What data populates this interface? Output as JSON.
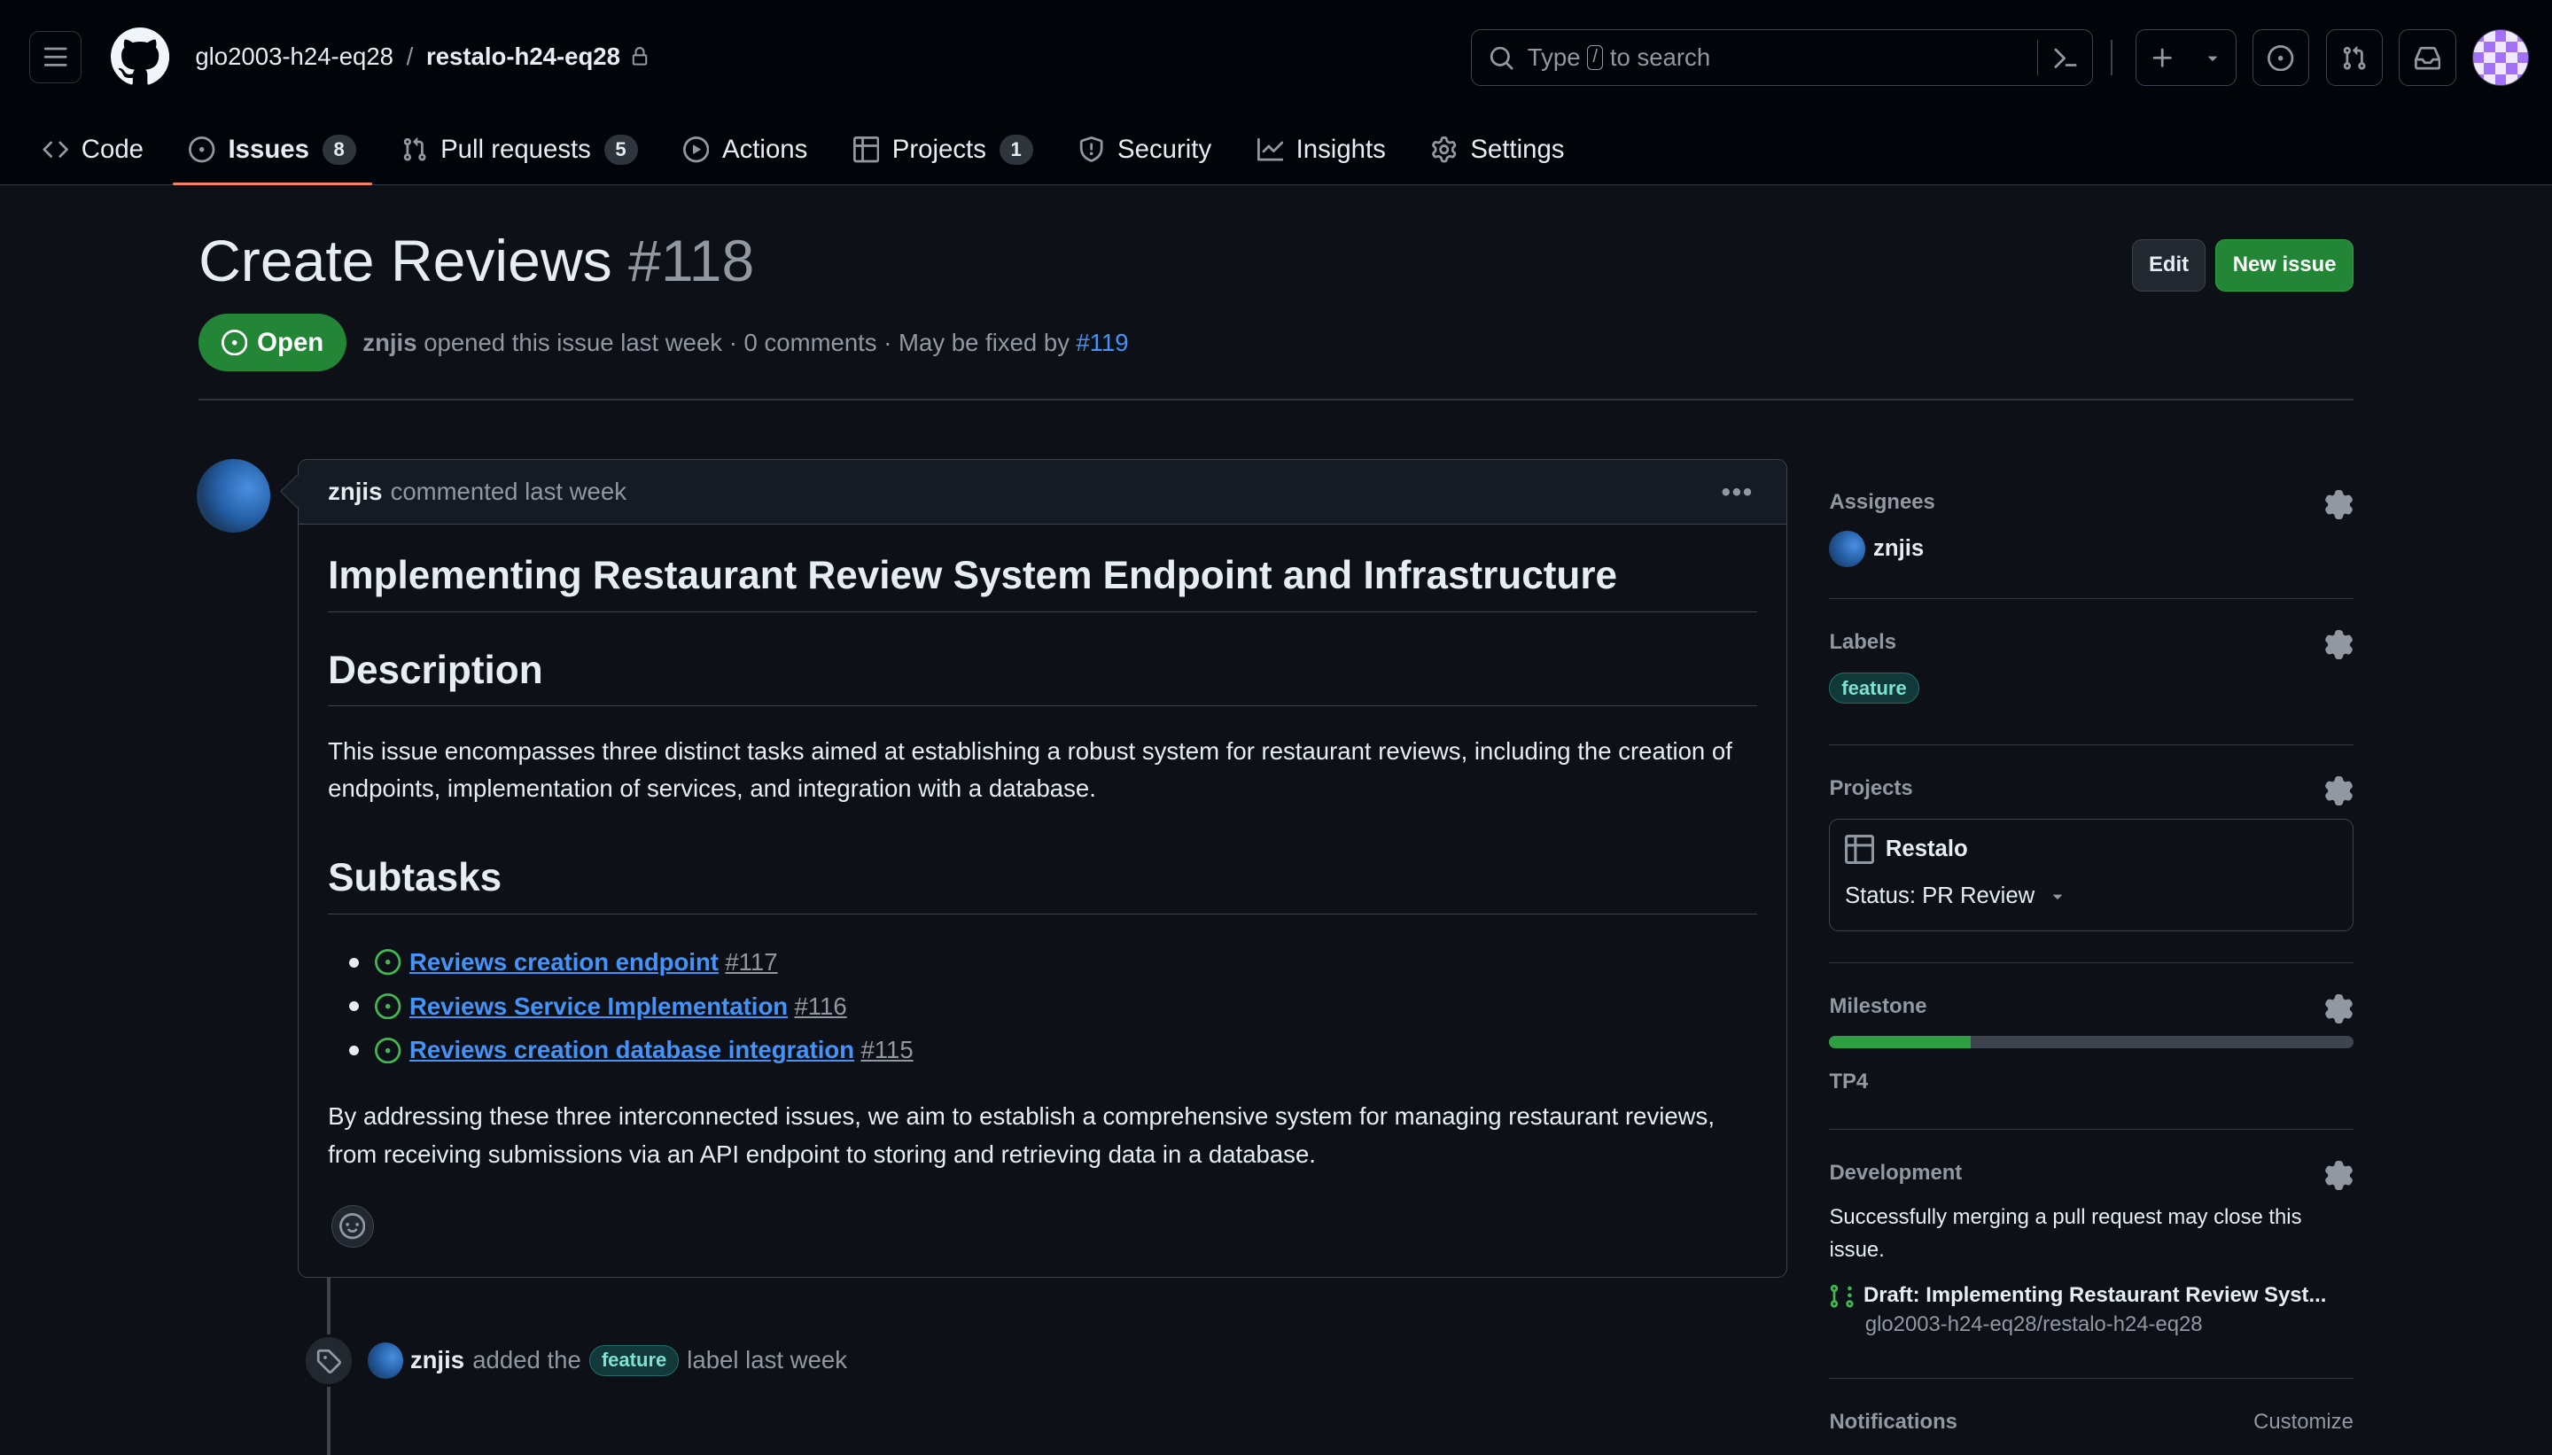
{
  "header": {
    "owner": "glo2003-h24-eq28",
    "repo": "restalo-h24-eq28",
    "search_prefix": "Type",
    "search_key": "/",
    "search_suffix": "to search"
  },
  "tabs": [
    {
      "label": "Code",
      "icon": "code-icon"
    },
    {
      "label": "Issues",
      "count": "8",
      "icon": "issue-opened-icon",
      "active": true
    },
    {
      "label": "Pull requests",
      "count": "5",
      "icon": "git-pull-request-icon"
    },
    {
      "label": "Actions",
      "icon": "play-icon"
    },
    {
      "label": "Projects",
      "count": "1",
      "icon": "table-icon"
    },
    {
      "label": "Security",
      "icon": "shield-icon"
    },
    {
      "label": "Insights",
      "icon": "graph-icon"
    },
    {
      "label": "Settings",
      "icon": "gear-icon"
    }
  ],
  "issue": {
    "title": "Create Reviews",
    "number": "#118",
    "edit_label": "Edit",
    "new_issue_label": "New issue",
    "state": "Open",
    "author": "znjis",
    "meta_text": "opened this issue last week · 0 comments · May be fixed by",
    "fixed_by": "#119"
  },
  "comment": {
    "author": "znjis",
    "time": "commented last week",
    "heading": "Implementing Restaurant Review System Endpoint and Infrastructure",
    "desc_heading": "Description",
    "desc_text": "This issue encompasses three distinct tasks aimed at establishing a robust system for restaurant reviews, including the creation of endpoints, implementation of services, and integration with a database.",
    "subtasks_heading": "Subtasks",
    "subtasks": [
      {
        "title": "Reviews creation endpoint",
        "number": "#117"
      },
      {
        "title": "Reviews Service Implementation",
        "number": "#116"
      },
      {
        "title": "Reviews creation database integration",
        "number": "#115"
      }
    ],
    "closing_text": "By addressing these three interconnected issues, we aim to establish a comprehensive system for managing restaurant reviews, from receiving submissions via an API endpoint to storing and retrieving data in a database."
  },
  "event": {
    "actor": "znjis",
    "before": "added the",
    "label": "feature",
    "after": "label last week"
  },
  "sidebar": {
    "assignees_heading": "Assignees",
    "assignee": "znjis",
    "labels_heading": "Labels",
    "label": "feature",
    "projects_heading": "Projects",
    "project_name": "Restalo",
    "project_status": "Status: PR Review",
    "milestone_heading": "Milestone",
    "milestone_progress": 0.27,
    "milestone_name": "TP4",
    "development_heading": "Development",
    "development_text": "Successfully merging a pull request may close this issue.",
    "pr_title": "Draft: Implementing Restaurant Review Syst...",
    "pr_repo": "glo2003-h24-eq28/restalo-h24-eq28",
    "notifications_heading": "Notifications",
    "customize_label": "Customize"
  },
  "colors": {
    "background": "#0d1117",
    "header_bg": "#010409",
    "accent_link": "#4493f8",
    "open_green": "#238636",
    "tab_underline": "#f78166"
  }
}
